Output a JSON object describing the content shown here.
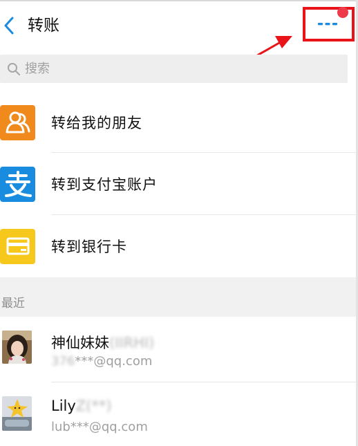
{
  "nav": {
    "title": "转账",
    "back_icon": "chevron-left-icon",
    "more_icon": "ellipsis-icon",
    "accent": "#1a8ce0",
    "highlight_color": "#e8141a",
    "badge_color": "#ef3a4a"
  },
  "search": {
    "placeholder": "搜索",
    "icon": "search-icon"
  },
  "menu": [
    {
      "label": "转给我的朋友",
      "icon": "friends-icon",
      "color": "#f08a1c"
    },
    {
      "label": "转到支付宝账户",
      "icon": "alipay-icon",
      "color": "#1a8ce0"
    },
    {
      "label": "转到银行卡",
      "icon": "bank-card-icon",
      "color": "#f6c81b"
    }
  ],
  "recent": {
    "label": "最近",
    "contacts": [
      {
        "name": "神仙妹妹",
        "name_masked": "(IIRHI)",
        "email_masked": "376",
        "email": "***@qq.com"
      },
      {
        "name": "Lily",
        "name_masked": "Z(**)",
        "email_masked": "",
        "email": "lub***@qq.com"
      }
    ]
  }
}
